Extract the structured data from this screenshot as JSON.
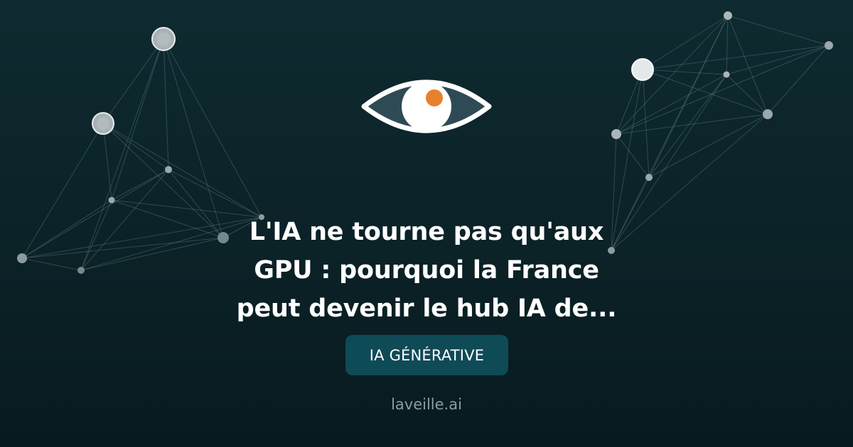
{
  "headline": {
    "line1": "L'IA ne tourne pas qu'aux",
    "line2": "GPU : pourquoi la France",
    "line3": "peut devenir le hub IA de..."
  },
  "category": {
    "label": "IA GÉNÉRATIVE"
  },
  "site": {
    "domain": "laveille.ai"
  },
  "logo": {
    "icon": "eye-icon",
    "pupil_color": "#e8812c"
  },
  "colors": {
    "background": "#0b2227",
    "badge": "#0f4a57",
    "text": "#ffffff",
    "muted_text": "#8b9da2"
  }
}
